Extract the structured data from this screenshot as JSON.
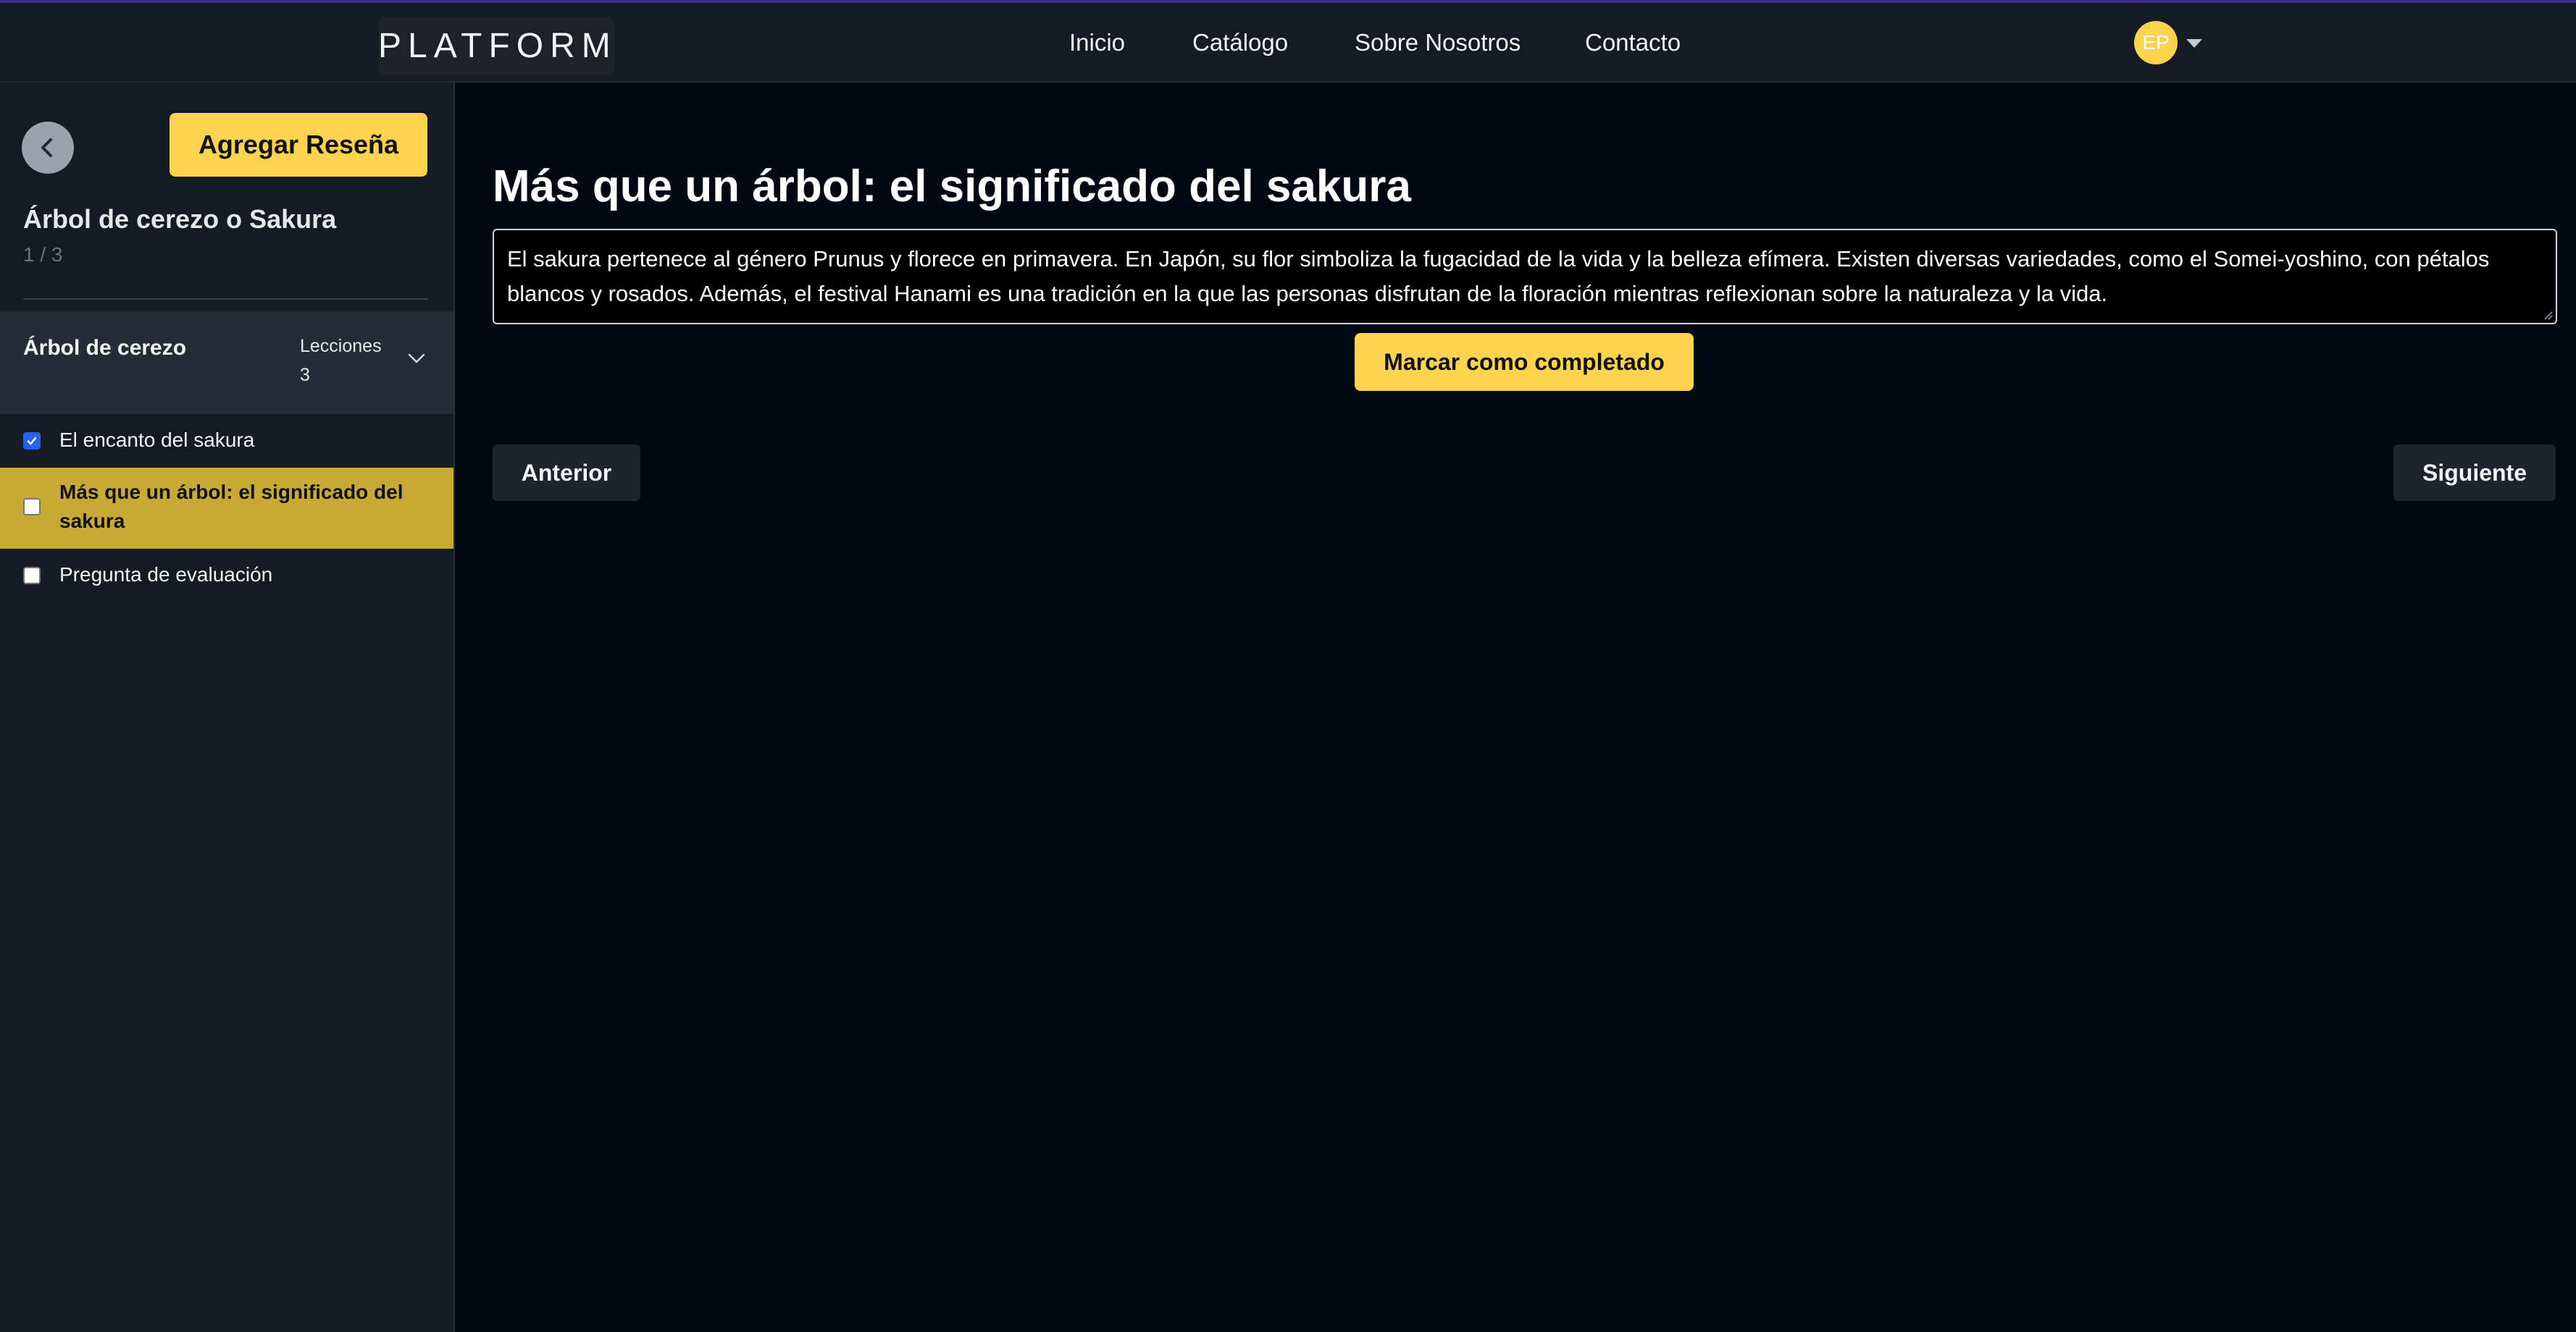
{
  "navbar": {
    "logo": "PLATFORM",
    "links": [
      "Inicio",
      "Catálogo",
      "Sobre Nosotros",
      "Contacto"
    ],
    "avatar_initials": "EP"
  },
  "sidebar": {
    "review_button": "Agregar Reseña",
    "course_title": "Árbol de cerezo o Sakura",
    "progress": "1 / 3",
    "module": {
      "title": "Árbol de cerezo",
      "lessons_label": "Lecciones",
      "lessons_count": "3"
    },
    "lessons": [
      {
        "label": "El encanto del sakura",
        "completed": true,
        "active": false
      },
      {
        "label": "Más que un árbol: el significado del sakura",
        "completed": false,
        "active": true
      },
      {
        "label": "Pregunta de evaluación",
        "completed": false,
        "active": false
      }
    ]
  },
  "main": {
    "title": "Más que un árbol: el significado del sakura",
    "content": "El sakura pertenece al género Prunus y florece en primavera. En Japón, su flor simboliza la fugacidad de la vida y la belleza efímera. Existen diversas variedades, como el Somei-yoshino, con pétalos blancos y rosados. Además, el festival Hanami es una tradición en la que las personas disfrutan de la floración mientras reflexionan sobre la naturaleza y la vida.",
    "complete_button": "Marcar como completado",
    "prev_button": "Anterior",
    "next_button": "Siguiente"
  },
  "colors": {
    "accent": "#fcd34d",
    "active_lesson": "#c9a935",
    "background": "#030712",
    "panel": "#161a22"
  }
}
